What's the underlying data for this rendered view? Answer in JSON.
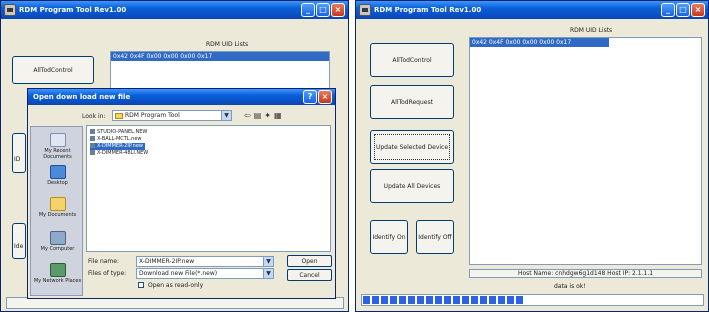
{
  "left_window": {
    "title": "RDM Program Tool Rev1.00",
    "panel_title": "RDM UID Lists",
    "uid_rows": [
      "0x42 0x4F 0x00 0x00 0x00 0x17"
    ],
    "button_fragments": [
      "ID",
      "Ide"
    ]
  },
  "right_window": {
    "title": "RDM Program Tool Rev1.00",
    "panel_title": "RDM UID Lists",
    "uid_rows": [
      "0x42 0x4F 0x00 0x00 0x00 0x17"
    ],
    "buttons": {
      "all_tod_control": "AllTodControl",
      "all_tod_request": "AllTodRequest",
      "update_selected": "Update Selected Device",
      "update_all": "Update All Devices",
      "identify_on": "Identify On",
      "identify_off": "Identify Off"
    },
    "host_info": "Host Name: cnhdgw6g1d148    Host IP: 2.1.1.1",
    "status": "data is ok!",
    "progress_fraction": 0.5
  },
  "dialog": {
    "title": "Open down load new file",
    "look_in_label": "Look in:",
    "look_in_value": "RDM Program Tool",
    "places": [
      "My Recent Documents",
      "Desktop",
      "My Documents",
      "My Computer",
      "My Network Places"
    ],
    "files": [
      "STUDIO-PANEL.NEW",
      "X-BALL-MCTL.new",
      "X-DIMMER-2IP.new",
      "X-DIMMER-48LI.NEW"
    ],
    "selected_file_index": 2,
    "file_name_label": "File name:",
    "file_name_value": "X-DIMMER-2IP.new",
    "file_type_label": "Files of type:",
    "file_type_value": "Download new File(*.new)",
    "read_only_label": "Open as read-only",
    "open_label": "Open",
    "cancel_label": "Cancel"
  },
  "colors": {
    "titlebar": "#0a53c9",
    "selection": "#316ac5",
    "progress": "#2f62e0"
  }
}
